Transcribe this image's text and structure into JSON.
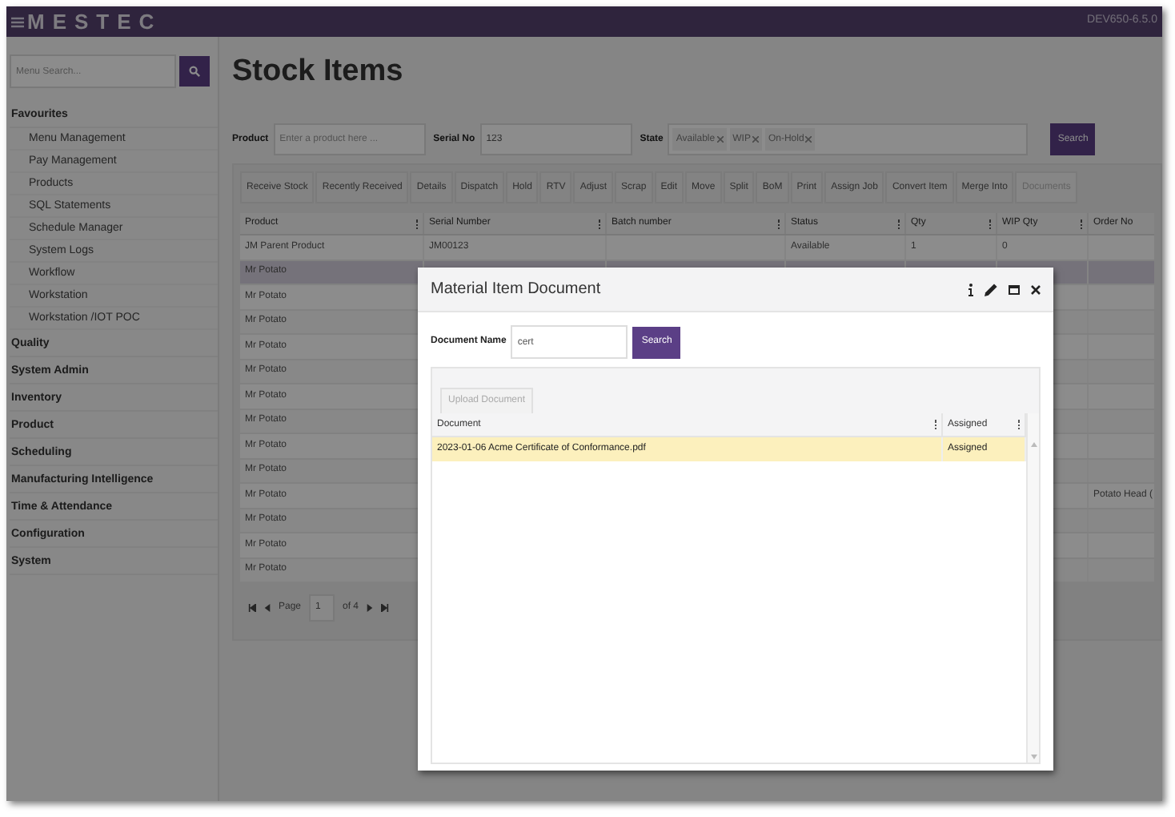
{
  "header": {
    "logo": "MESTEC",
    "version": "DEV650-6.5.0"
  },
  "sidebar": {
    "search_placeholder": "Menu Search...",
    "sections": [
      {
        "label": "Favourites",
        "children": [
          {
            "label": "Menu Management"
          },
          {
            "label": "Pay Management"
          },
          {
            "label": "Products"
          },
          {
            "label": "SQL Statements"
          },
          {
            "label": "Schedule Manager"
          },
          {
            "label": "System Logs"
          },
          {
            "label": "Workflow"
          },
          {
            "label": "Workstation"
          },
          {
            "label": "Workstation /IOT POC"
          }
        ]
      },
      {
        "label": "Quality"
      },
      {
        "label": "System Admin"
      },
      {
        "label": "Inventory"
      },
      {
        "label": "Product"
      },
      {
        "label": "Scheduling"
      },
      {
        "label": "Manufacturing Intelligence"
      },
      {
        "label": "Time & Attendance"
      },
      {
        "label": "Configuration"
      },
      {
        "label": "System"
      }
    ]
  },
  "page": {
    "title": "Stock Items"
  },
  "filters": {
    "product": {
      "label": "Product",
      "placeholder": "Enter a product here ..."
    },
    "serial": {
      "label": "Serial No",
      "value": "123"
    },
    "state": {
      "label": "State",
      "tags": [
        "Available",
        "WIP",
        "On-Hold"
      ]
    },
    "search_button": "Search"
  },
  "toolbar": [
    {
      "label": "Receive Stock",
      "disabled": false
    },
    {
      "label": "Recently Received",
      "disabled": false
    },
    {
      "label": "Details",
      "disabled": false
    },
    {
      "label": "Dispatch",
      "disabled": false
    },
    {
      "label": "Hold",
      "disabled": false
    },
    {
      "label": "RTV",
      "disabled": false
    },
    {
      "label": "Adjust",
      "disabled": false
    },
    {
      "label": "Scrap",
      "disabled": false
    },
    {
      "label": "Edit",
      "disabled": false
    },
    {
      "label": "Move",
      "disabled": false
    },
    {
      "label": "Split",
      "disabled": false
    },
    {
      "label": "BoM",
      "disabled": false
    },
    {
      "label": "Print",
      "disabled": false
    },
    {
      "label": "Assign Job",
      "disabled": false
    },
    {
      "label": "Convert Item",
      "disabled": false
    },
    {
      "label": "Merge Into",
      "disabled": false
    },
    {
      "label": "Documents",
      "disabled": true
    }
  ],
  "table": {
    "columns": [
      {
        "label": "Product"
      },
      {
        "label": "Serial Number"
      },
      {
        "label": "Batch number"
      },
      {
        "label": "Status"
      },
      {
        "label": "Qty"
      },
      {
        "label": "WIP Qty"
      },
      {
        "label": "Order No"
      }
    ],
    "rows": [
      {
        "product": "JM Parent Product",
        "serial_number": "JM00123",
        "status": "Available",
        "qty": "1",
        "wip_qty": "0",
        "selected": false
      },
      {
        "product": "Mr Potato",
        "selected": true
      },
      {
        "product": "Mr Potato",
        "selected": false
      },
      {
        "product": "Mr Potato",
        "selected": false
      },
      {
        "product": "Mr Potato",
        "selected": false
      },
      {
        "product": "Mr Potato",
        "selected": false
      },
      {
        "product": "Mr Potato",
        "selected": false
      },
      {
        "product": "Mr Potato",
        "selected": false
      },
      {
        "product": "Mr Potato",
        "selected": false
      },
      {
        "product": "Mr Potato",
        "selected": false
      },
      {
        "product": "Mr Potato",
        "order_no": "Potato Head (",
        "selected": false
      },
      {
        "product": "Mr Potato",
        "selected": false
      },
      {
        "product": "Mr Potato",
        "selected": false
      },
      {
        "product": "Mr Potato",
        "selected": false
      }
    ]
  },
  "pager": {
    "page_label": "Page",
    "page": "1",
    "of": "of 4"
  },
  "dialog": {
    "title": "Material Item Document",
    "field": {
      "label": "Document Name",
      "value": "cert"
    },
    "search_button": "Search",
    "upload_button": {
      "label": "Upload Document",
      "disabled": true
    },
    "columns": [
      {
        "label": "Document"
      },
      {
        "label": "Assigned"
      }
    ],
    "rows": [
      {
        "document": "2023-01-06 Acme Certificate of Conformance.pdf",
        "assigned": "Assigned",
        "selected": true
      }
    ]
  }
}
